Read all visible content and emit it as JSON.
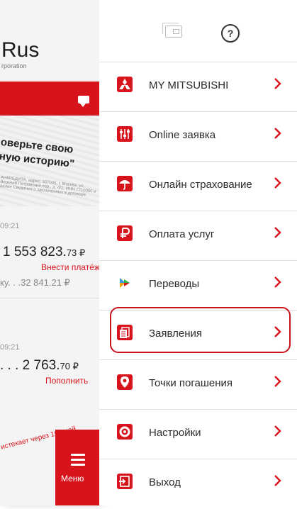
{
  "background_page": {
    "brand": "Rus",
    "brand_sub": "rporation",
    "promo_text_line1": "оверьте свою",
    "promo_text_line2": "ную историю\"",
    "promo_fine": "АНКРЕДИТА, адрес: 107045, г. Москва, ул. Верхний Петровский пер., д. 4/1, ИНН 7710000 и далее Сведения о заключенных в договоре.",
    "account1": {
      "time": "09:21",
      "amount_main": "1 553 823.",
      "amount_cents": "73 ₽",
      "action": "Внести платёж",
      "secondary": "ку. . .32 841.21 ₽"
    },
    "account2": {
      "time": "09:21",
      "amount_main": ". . . 2 763.",
      "amount_cents": "70 ₽",
      "action": "Пополнить"
    },
    "expire_notice": "истекает через 16 дней",
    "menu_button_label": "Меню"
  },
  "menu": {
    "items": [
      {
        "label": "MY MITSUBISHI",
        "icon": "mitsubishi-logo-icon"
      },
      {
        "label": "Online заявка",
        "icon": "sliders-icon"
      },
      {
        "label": "Онлайн страхование",
        "icon": "umbrella-icon"
      },
      {
        "label": "Оплата услуг",
        "icon": "ruble-icon"
      },
      {
        "label": "Переводы",
        "icon": "transfer-arrows-icon"
      },
      {
        "label": "Заявления",
        "icon": "documents-icon",
        "highlighted": true
      },
      {
        "label": "Точки погашения",
        "icon": "location-pin-icon"
      },
      {
        "label": "Настройки",
        "icon": "gear-icon"
      },
      {
        "label": "Выход",
        "icon": "exit-icon"
      }
    ]
  },
  "colors": {
    "accent": "#d7141c",
    "highlight_border": "#c8141f",
    "text": "#2b2b2b",
    "divider": "#e0e0e0"
  }
}
